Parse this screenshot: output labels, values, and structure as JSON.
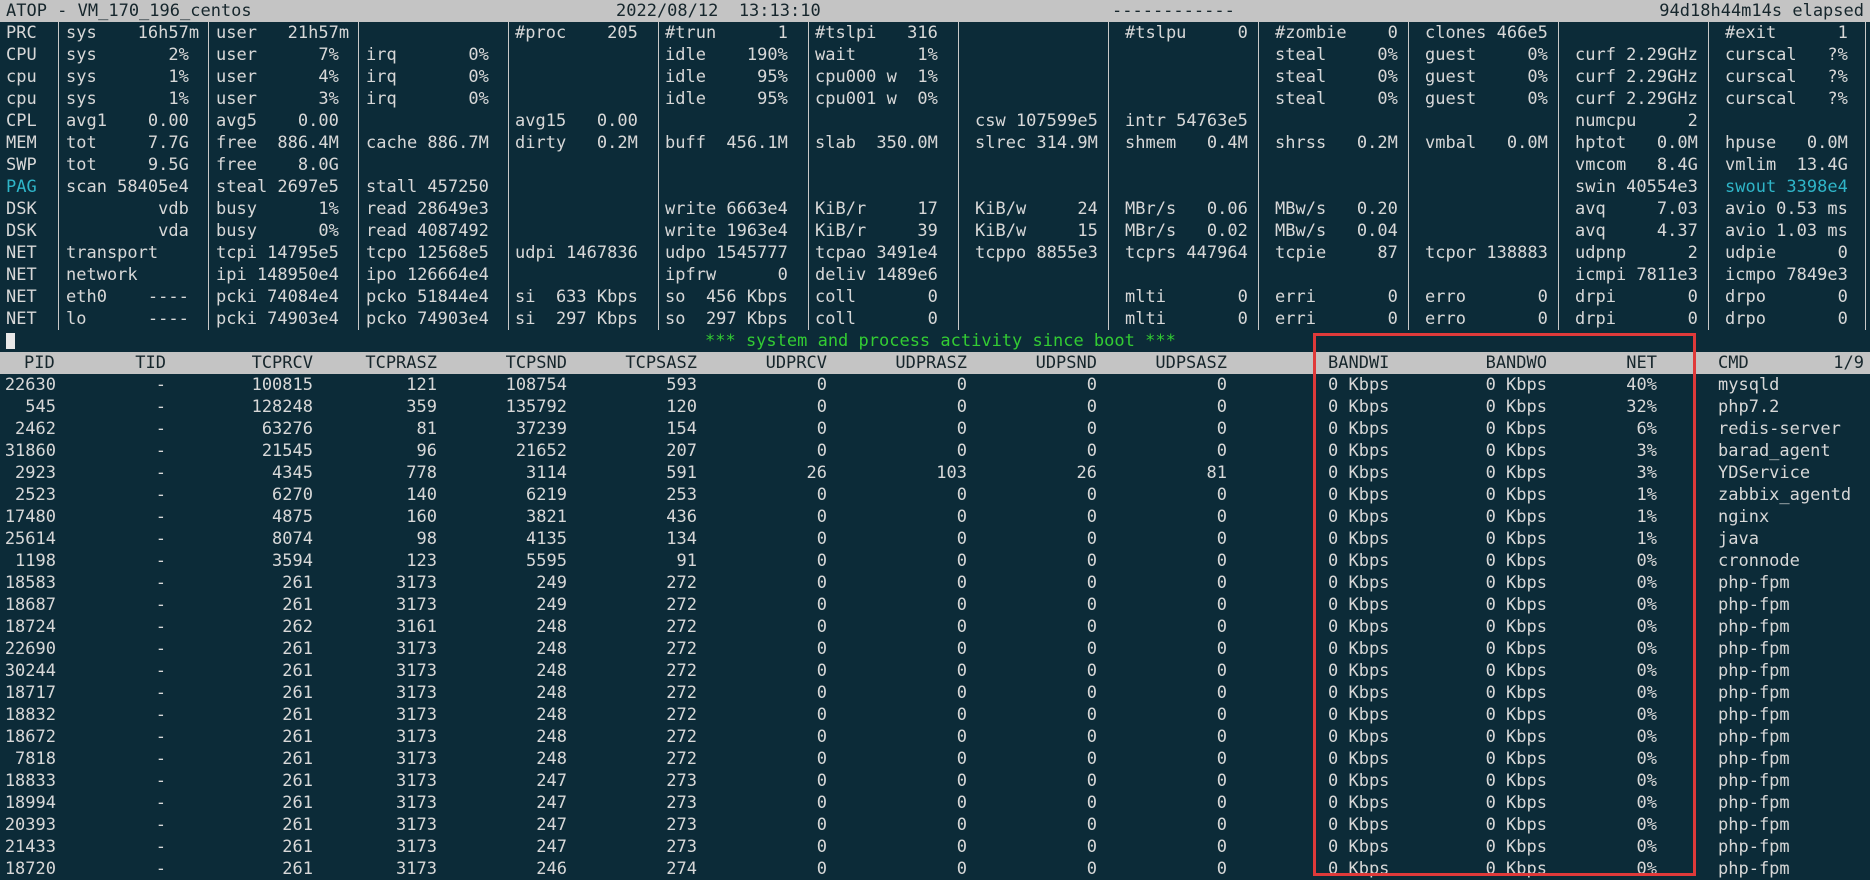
{
  "header": {
    "title": "ATOP - VM_170_196_centos",
    "datetime": "2022/08/12  13:13:10",
    "dashes": "------------",
    "elapsed": "94d18h44m14s elapsed"
  },
  "colors": {
    "background": "#0c2b38",
    "text": "#d8d8d8",
    "highlight": "#2fb5c8",
    "banner": "#33cc33",
    "header_bar": "#c4c4c4",
    "annotation_box": "#e03a3a"
  },
  "sys_rows": [
    {
      "label": "PRC",
      "cells": [
        "sys    16h57m",
        "user   21h57m",
        "",
        "#proc    205",
        "#trun      1",
        "#tslpi   316",
        "",
        "#tslpu     0",
        "#zombie    0",
        "clones 466e5",
        "",
        "#exit      1"
      ]
    },
    {
      "label": "CPU",
      "cells": [
        "sys       2%",
        "user      7%",
        "irq       0%",
        "",
        "idle    190%",
        "wait      1%",
        "",
        "",
        "steal     0%",
        "guest     0%",
        "curf 2.29GHz",
        "curscal   ?%"
      ]
    },
    {
      "label": "cpu",
      "cells": [
        "sys       1%",
        "user      4%",
        "irq       0%",
        "",
        "idle     95%",
        "cpu000 w  1%",
        "",
        "",
        "steal     0%",
        "guest     0%",
        "curf 2.29GHz",
        "curscal   ?%"
      ]
    },
    {
      "label": "cpu",
      "cells": [
        "sys       1%",
        "user      3%",
        "irq       0%",
        "",
        "idle     95%",
        "cpu001 w  0%",
        "",
        "",
        "steal     0%",
        "guest     0%",
        "curf 2.29GHz",
        "curscal   ?%"
      ]
    },
    {
      "label": "CPL",
      "cells": [
        "avg1    0.00",
        "avg5    0.00",
        "",
        "avg15   0.00",
        "",
        "",
        "csw 107599e5",
        "intr 54763e5",
        "",
        "",
        "numcpu     2",
        ""
      ]
    },
    {
      "label": "MEM",
      "cells": [
        "tot     7.7G",
        "free  886.4M",
        "cache 886.7M",
        "dirty   0.2M",
        "buff  456.1M",
        "slab  350.0M",
        "slrec 314.9M",
        "shmem   0.4M",
        "shrss   0.2M",
        "vmbal   0.0M",
        "hptot   0.0M",
        "hpuse   0.0M"
      ]
    },
    {
      "label": "SWP",
      "cells": [
        "tot     9.5G",
        "free    8.0G",
        "",
        "",
        "",
        "",
        "",
        "",
        "",
        "",
        "vmcom   8.4G",
        "vmlim  13.4G"
      ]
    },
    {
      "label": "PAG",
      "hl": true,
      "cells": [
        "scan 58405e4",
        "steal 2697e5",
        "stall 457250",
        "",
        "",
        "",
        "",
        "",
        "",
        "",
        "swin 40554e3",
        "swout 3398e4"
      ]
    },
    {
      "label": "DSK",
      "cells": [
        "         vdb",
        "busy      1%",
        "read 28649e3",
        "",
        "write 6663e4",
        "KiB/r     17",
        "KiB/w     24",
        "MBr/s   0.06",
        "MBw/s   0.20",
        "",
        "avq     7.03",
        "avio 0.53 ms"
      ]
    },
    {
      "label": "DSK",
      "cells": [
        "         vda",
        "busy      0%",
        "read 4087492",
        "",
        "write 1963e4",
        "KiB/r     39",
        "KiB/w     15",
        "MBr/s   0.02",
        "MBw/s   0.04",
        "",
        "avq     4.37",
        "avio 1.03 ms"
      ]
    },
    {
      "label": "NET",
      "cells": [
        "transport",
        "tcpi 14795e5",
        "tcpo 12568e5",
        "udpi 1467836",
        "udpo 1545777",
        "tcpao 3491e4",
        "tcppo 8855e3",
        "tcprs 447964",
        "tcpie     87",
        "tcpor 138883",
        "udpnp      2",
        "udpie      0"
      ]
    },
    {
      "label": "NET",
      "cells": [
        "network",
        "ipi 148950e4",
        "ipo 126664e4",
        "",
        "ipfrw      0",
        "deliv 1489e6",
        "",
        "",
        "",
        "",
        "icmpi 7811e3",
        "icmpo 7849e3"
      ]
    },
    {
      "label": "NET",
      "cells": [
        "eth0    ----",
        "pcki 74084e4",
        "pcko 51844e4",
        "si  633 Kbps",
        "so  456 Kbps",
        "coll       0",
        "",
        "mlti       0",
        "erri       0",
        "erro       0",
        "drpi       0",
        "drpo       0"
      ]
    },
    {
      "label": "NET",
      "cells": [
        "lo      ----",
        "pcki 74903e4",
        "pcko 74903e4",
        "si  297 Kbps",
        "so  297 Kbps",
        "coll       0",
        "",
        "mlti       0",
        "erri       0",
        "erro       0",
        "drpi       0",
        "drpo       0"
      ]
    }
  ],
  "banner": "*** system and process activity since boot ***",
  "proc_table": {
    "columns": [
      "PID",
      "TID",
      "TCPRCV",
      "TCPRASZ",
      "TCPSND",
      "TCPSASZ",
      "UDPRCV",
      "UDPRASZ",
      "UDPSND",
      "UDPSASZ",
      "BANDWI",
      "BANDWO",
      "NET",
      "CMD"
    ],
    "page": "1/9",
    "rows": [
      [
        "22630",
        "-",
        "100815",
        "121",
        "108754",
        "593",
        "0",
        "0",
        "0",
        "0",
        "0 Kbps",
        "0 Kbps",
        "40%",
        "mysqld"
      ],
      [
        "545",
        "-",
        "128248",
        "359",
        "135792",
        "120",
        "0",
        "0",
        "0",
        "0",
        "0 Kbps",
        "0 Kbps",
        "32%",
        "php7.2"
      ],
      [
        "2462",
        "-",
        "63276",
        "81",
        "37239",
        "154",
        "0",
        "0",
        "0",
        "0",
        "0 Kbps",
        "0 Kbps",
        "6%",
        "redis-server"
      ],
      [
        "31860",
        "-",
        "21545",
        "96",
        "21652",
        "207",
        "0",
        "0",
        "0",
        "0",
        "0 Kbps",
        "0 Kbps",
        "3%",
        "barad_agent"
      ],
      [
        "2923",
        "-",
        "4345",
        "778",
        "3114",
        "591",
        "26",
        "103",
        "26",
        "81",
        "0 Kbps",
        "0 Kbps",
        "3%",
        "YDService"
      ],
      [
        "2523",
        "-",
        "6270",
        "140",
        "6219",
        "253",
        "0",
        "0",
        "0",
        "0",
        "0 Kbps",
        "0 Kbps",
        "1%",
        "zabbix_agentd"
      ],
      [
        "17480",
        "-",
        "4875",
        "160",
        "3821",
        "436",
        "0",
        "0",
        "0",
        "0",
        "0 Kbps",
        "0 Kbps",
        "1%",
        "nginx"
      ],
      [
        "25614",
        "-",
        "8074",
        "98",
        "4135",
        "134",
        "0",
        "0",
        "0",
        "0",
        "0 Kbps",
        "0 Kbps",
        "1%",
        "java"
      ],
      [
        "1198",
        "-",
        "3594",
        "123",
        "5595",
        "91",
        "0",
        "0",
        "0",
        "0",
        "0 Kbps",
        "0 Kbps",
        "0%",
        "cronnode"
      ],
      [
        "18583",
        "-",
        "261",
        "3173",
        "249",
        "272",
        "0",
        "0",
        "0",
        "0",
        "0 Kbps",
        "0 Kbps",
        "0%",
        "php-fpm"
      ],
      [
        "18687",
        "-",
        "261",
        "3173",
        "249",
        "272",
        "0",
        "0",
        "0",
        "0",
        "0 Kbps",
        "0 Kbps",
        "0%",
        "php-fpm"
      ],
      [
        "18724",
        "-",
        "262",
        "3161",
        "248",
        "272",
        "0",
        "0",
        "0",
        "0",
        "0 Kbps",
        "0 Kbps",
        "0%",
        "php-fpm"
      ],
      [
        "22690",
        "-",
        "261",
        "3173",
        "248",
        "272",
        "0",
        "0",
        "0",
        "0",
        "0 Kbps",
        "0 Kbps",
        "0%",
        "php-fpm"
      ],
      [
        "30244",
        "-",
        "261",
        "3173",
        "248",
        "272",
        "0",
        "0",
        "0",
        "0",
        "0 Kbps",
        "0 Kbps",
        "0%",
        "php-fpm"
      ],
      [
        "18717",
        "-",
        "261",
        "3173",
        "248",
        "272",
        "0",
        "0",
        "0",
        "0",
        "0 Kbps",
        "0 Kbps",
        "0%",
        "php-fpm"
      ],
      [
        "18832",
        "-",
        "261",
        "3173",
        "248",
        "272",
        "0",
        "0",
        "0",
        "0",
        "0 Kbps",
        "0 Kbps",
        "0%",
        "php-fpm"
      ],
      [
        "18672",
        "-",
        "261",
        "3173",
        "248",
        "272",
        "0",
        "0",
        "0",
        "0",
        "0 Kbps",
        "0 Kbps",
        "0%",
        "php-fpm"
      ],
      [
        "7818",
        "-",
        "261",
        "3173",
        "248",
        "272",
        "0",
        "0",
        "0",
        "0",
        "0 Kbps",
        "0 Kbps",
        "0%",
        "php-fpm"
      ],
      [
        "18833",
        "-",
        "261",
        "3173",
        "247",
        "273",
        "0",
        "0",
        "0",
        "0",
        "0 Kbps",
        "0 Kbps",
        "0%",
        "php-fpm"
      ],
      [
        "18994",
        "-",
        "261",
        "3173",
        "247",
        "273",
        "0",
        "0",
        "0",
        "0",
        "0 Kbps",
        "0 Kbps",
        "0%",
        "php-fpm"
      ],
      [
        "20393",
        "-",
        "261",
        "3173",
        "247",
        "273",
        "0",
        "0",
        "0",
        "0",
        "0 Kbps",
        "0 Kbps",
        "0%",
        "php-fpm"
      ],
      [
        "21433",
        "-",
        "261",
        "3173",
        "247",
        "273",
        "0",
        "0",
        "0",
        "0",
        "0 Kbps",
        "0 Kbps",
        "0%",
        "php-fpm"
      ],
      [
        "18720",
        "-",
        "261",
        "3173",
        "246",
        "274",
        "0",
        "0",
        "0",
        "0",
        "0 Kbps",
        "0 Kbps",
        "0%",
        "php-fpm"
      ]
    ]
  }
}
